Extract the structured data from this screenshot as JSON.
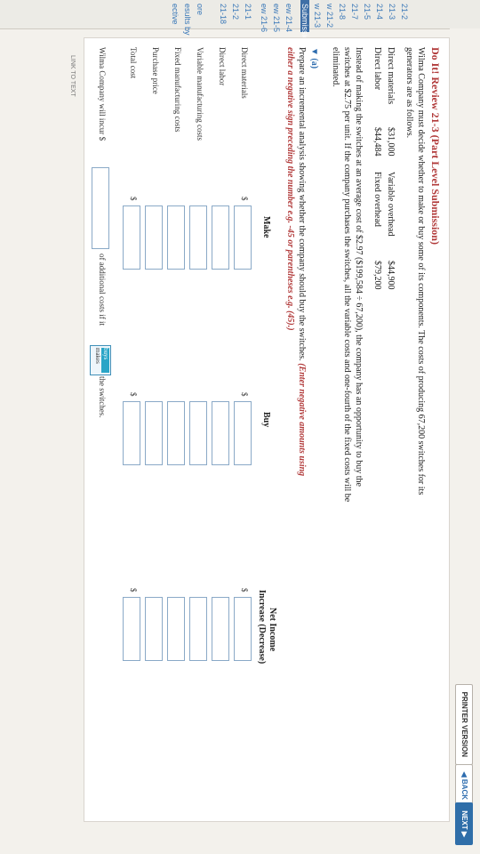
{
  "nav": {
    "items": [
      "21-2",
      "21-3",
      "21-4",
      "21-5",
      "21-7",
      "21-8",
      "w 21-2",
      "w 21-3",
      "Submission)",
      "ew 21-4",
      "ew 21-5",
      "ew 21-6",
      "21-1",
      "21-2",
      "21-18",
      "ore",
      "esults by",
      "ective"
    ]
  },
  "toolbar": {
    "printer": "PRINTER VERSION",
    "back": "◀ BACK",
    "next": "NEXT ▶"
  },
  "problem": {
    "title": "Do It! Review 21-3 (Part Level Submission)",
    "intro1": "Wilma Company must decide whether to make or buy some of its components. The costs of producing 67,200 switches for its",
    "intro2": "generators are as follows.",
    "costs": {
      "dm_label": "Direct materials",
      "dm_value": "$31,000",
      "vo_label": "Variable overhead",
      "vo_value": "$44,900",
      "dl_label": "Direct labor",
      "dl_value": "$44,484",
      "fo_label": "Fixed overhead",
      "fo_value": "$79,200"
    },
    "para1": "Instead of making the switches at an average cost of $2.97 ($199,584 ÷ 67,200), the company has an opportunity to buy the",
    "para2": "switches at $2.75 per unit. If the company purchases the switches, all the variable costs and one-fourth of the fixed costs will be",
    "para3": "eliminated."
  },
  "part_a": {
    "label": "▼ (a)",
    "instr1": "Prepare an incremental analysis showing whether the company should buy the switches.",
    "instr_red1": "(Enter negative amounts using",
    "instr_red2": "either a negative sign preceding the number e.g. -45 or parentheses e.g. (45).)"
  },
  "table": {
    "col_make": "Make",
    "col_buy": "Buy",
    "col_net1": "Net Income",
    "col_net2": "Increase (Decrease)",
    "rows": [
      "Direct materials",
      "Direct labor",
      "Variable manufacturing costs",
      "Fixed manufacturing costs",
      "Purchase price",
      "Total cost"
    ],
    "dollar": "$"
  },
  "conclusion": {
    "prefix": "Wilma Company will incur $",
    "middle": "of additional costs if it",
    "option1": "buys",
    "option2": "makes",
    "suffix": "the switches."
  },
  "footer": {
    "link": "LINK TO TEXT"
  }
}
